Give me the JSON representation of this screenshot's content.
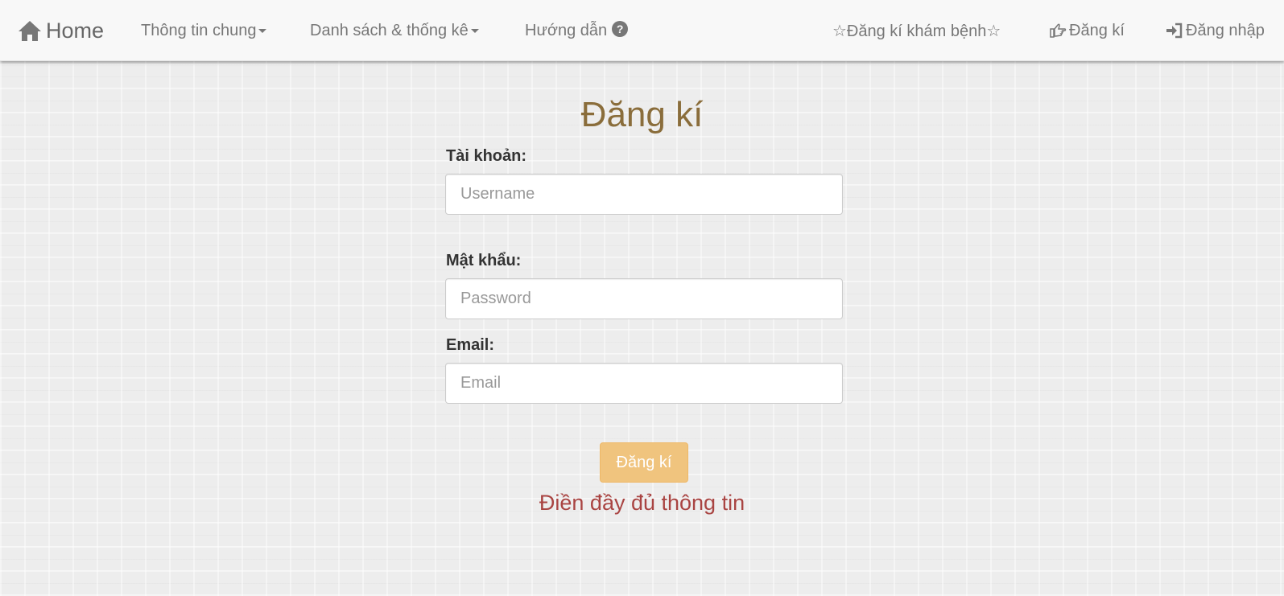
{
  "nav": {
    "brand": "Home",
    "menu_general": "Thông tin chung",
    "menu_lists": "Danh sách & thống kê",
    "menu_guide": "Hướng dẫn",
    "register_exam": "☆Đăng kí khám bệnh☆",
    "register": "Đăng kí",
    "login": "Đăng nhập"
  },
  "form": {
    "title": "Đăng kí",
    "username_label": "Tài khoản:",
    "username_placeholder": "Username",
    "password_label": "Mật khẩu:",
    "password_placeholder": "Password",
    "email_label": "Email:",
    "email_placeholder": "Email",
    "submit_label": "Đăng kí",
    "error_message": "Điền đầy đủ thông tin"
  },
  "colors": {
    "title": "#8a6d3b",
    "button": "#f0c47e",
    "error": "#a94442"
  }
}
